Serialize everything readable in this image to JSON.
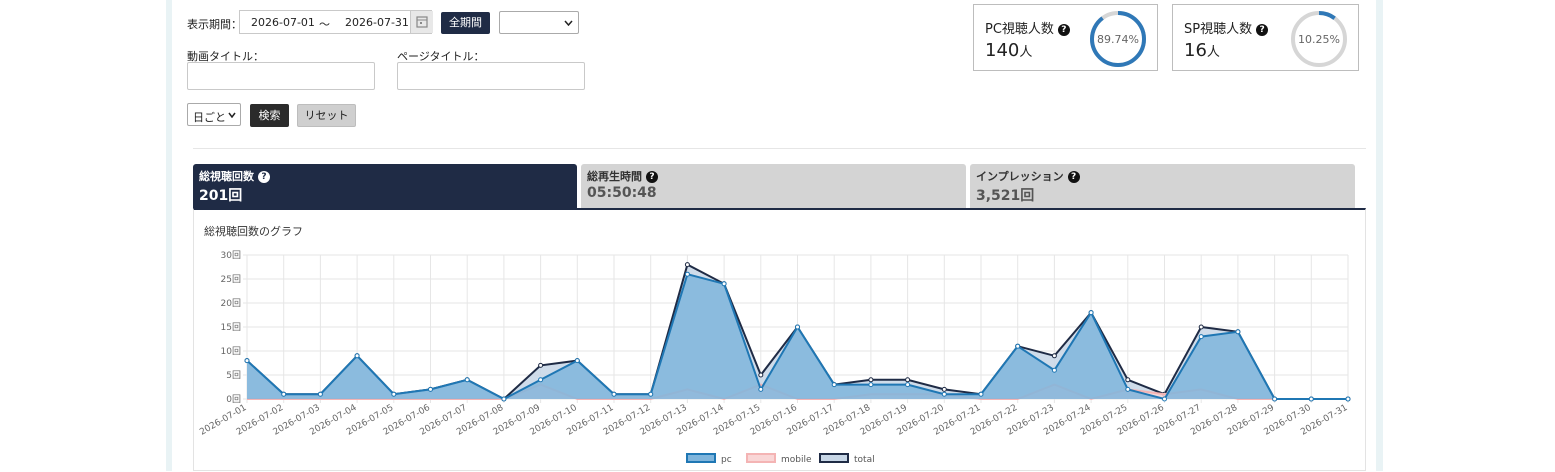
{
  "filters": {
    "period_label": "表示期間：",
    "date_from": "2026-07-01",
    "date_sep": "～",
    "date_to": "2026-07-31",
    "all_period_button": "全期間",
    "period_select_value": "",
    "video_title_label": "動画タイトル：",
    "video_title_value": "",
    "page_title_label": "ページタイトル：",
    "page_title_value": "",
    "granularity_value": "日ごと",
    "search_button": "検索",
    "reset_button": "リセット"
  },
  "stats": {
    "pc": {
      "label": "PC視聴人数",
      "value": "140",
      "unit": "人",
      "percent_text": "89.74%",
      "percent": 89.74,
      "color": "#2f78b7"
    },
    "sp": {
      "label": "SP視聴人数",
      "value": "16",
      "unit": "人",
      "percent_text": "10.25%",
      "percent": 10.25,
      "color": "#2f78b7"
    }
  },
  "tabs": [
    {
      "title": "総視聴回数",
      "value": "201回",
      "active": true
    },
    {
      "title": "総再生時間",
      "value": "05:50:48",
      "active": false
    },
    {
      "title": "インプレッション",
      "value": "3,521回",
      "active": false
    }
  ],
  "chart_data": {
    "type": "area",
    "title": "総視聴回数のグラフ",
    "x": [
      "2026-07-01",
      "2026-07-02",
      "2026-07-03",
      "2026-07-04",
      "2026-07-05",
      "2026-07-06",
      "2026-07-07",
      "2026-07-08",
      "2026-07-09",
      "2026-07-10",
      "2026-07-11",
      "2026-07-12",
      "2026-07-13",
      "2026-07-14",
      "2026-07-15",
      "2026-07-16",
      "2026-07-17",
      "2026-07-18",
      "2026-07-19",
      "2026-07-20",
      "2026-07-21",
      "2026-07-22",
      "2026-07-23",
      "2026-07-24",
      "2026-07-25",
      "2026-07-26",
      "2026-07-27",
      "2026-07-28",
      "2026-07-29",
      "2026-07-30",
      "2026-07-31"
    ],
    "yticks": [
      "0回",
      "5回",
      "10回",
      "15回",
      "20回",
      "25回",
      "30回"
    ],
    "ylim": [
      0,
      30
    ],
    "grid": true,
    "legend_position": "bottom",
    "series": [
      {
        "name": "pc",
        "color": "#1f77b4",
        "fill": "#7fb5dc",
        "values": [
          8,
          1,
          1,
          9,
          1,
          2,
          4,
          0,
          4,
          8,
          1,
          1,
          26,
          24,
          2,
          15,
          3,
          3,
          3,
          1,
          1,
          11,
          6,
          18,
          2,
          0,
          13,
          14,
          0,
          0,
          0
        ]
      },
      {
        "name": "mobile",
        "color": "#f4b4b4",
        "fill": "#f9d6d6",
        "values": [
          0,
          0,
          0,
          0,
          0,
          0,
          0,
          0,
          3,
          0,
          0,
          0,
          2,
          0,
          3,
          0,
          0,
          1,
          1,
          1,
          0,
          0,
          3,
          0,
          2,
          1,
          2,
          0,
          0,
          0,
          0
        ]
      },
      {
        "name": "total",
        "color": "#1f2b45",
        "fill": "#c7d6e6",
        "values": [
          8,
          1,
          1,
          9,
          1,
          2,
          4,
          0,
          7,
          8,
          1,
          1,
          28,
          24,
          5,
          15,
          3,
          4,
          4,
          2,
          1,
          11,
          9,
          18,
          4,
          1,
          15,
          14,
          0,
          0,
          0
        ]
      }
    ]
  }
}
